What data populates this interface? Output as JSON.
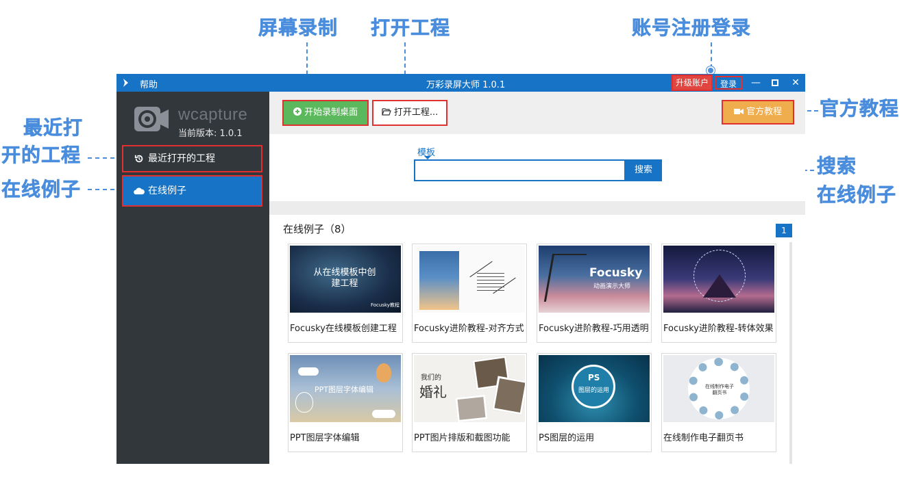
{
  "annotations": {
    "screen_record": "屏幕录制",
    "open_project": "打开工程",
    "account": "账号注册登录",
    "recent_line1": "最近打",
    "recent_line2": "开的工程",
    "online_examples": "在线例子",
    "official_tutorial": "官方教程",
    "search_line1": "搜索",
    "search_line2": "在线例子",
    "color": "#4a8ddc"
  },
  "titlebar": {
    "help": "帮助",
    "title": "万彩录屏大师 1.0.1",
    "upgrade": "升级账户",
    "login": "登录",
    "minimize": "—",
    "maximize": "□",
    "close": "✕",
    "color": "#1673c6"
  },
  "sidebar": {
    "brand_name": "wcapture",
    "version": "当前版本: 1.0.1",
    "items": [
      {
        "label": "最近打开的工程",
        "icon": "history-icon"
      },
      {
        "label": "在线例子",
        "icon": "cloud-icon"
      }
    ]
  },
  "toolbar": {
    "record_label": "开始录制桌面",
    "open_label": "打开工程...",
    "tutorial_label": "官方教程"
  },
  "search": {
    "label": "模板",
    "value": "",
    "placeholder": "",
    "button": "搜索"
  },
  "examples": {
    "section_title": "在线例子（8）",
    "page": "1",
    "cards": [
      {
        "title": "Focusky在线模板创建工程",
        "thumb_text": "从在线模板中创建工程",
        "thumb_caption": "Focusky教程"
      },
      {
        "title": "Focusky进阶教程-对齐方式",
        "thumb_text": ""
      },
      {
        "title": "Focusky进阶教程-巧用透明",
        "thumb_text": "Focusky",
        "thumb_caption": "动画演示大师"
      },
      {
        "title": "Focusky进阶教程-转体效果",
        "thumb_text": ""
      },
      {
        "title": "PPT图层字体编辑",
        "thumb_text": "PPT图层字体编辑"
      },
      {
        "title": "PPT图片排版和截图功能",
        "thumb_text": "我们的",
        "thumb_caption": "婚礼"
      },
      {
        "title": "PS图层的运用",
        "thumb_text": "PS",
        "thumb_caption": "图层的运用"
      },
      {
        "title": "在线制作电子翻页书",
        "thumb_text": "在线制作电子翻页书"
      }
    ]
  }
}
